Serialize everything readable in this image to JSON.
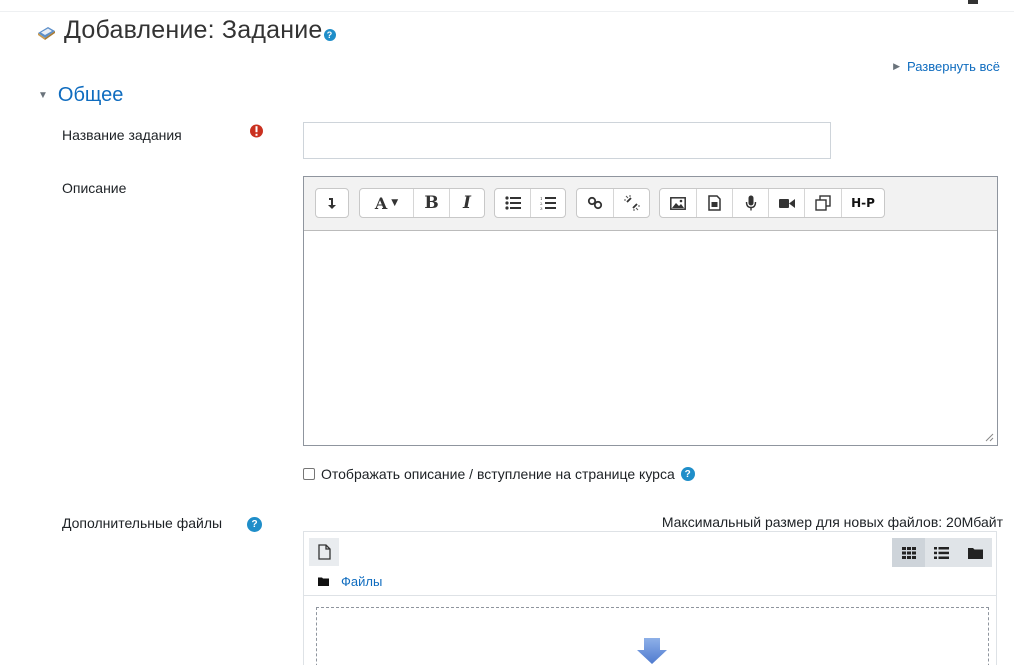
{
  "page": {
    "title": "Добавление: Задание",
    "expand_all": "Развернуть всё"
  },
  "section": {
    "general": "Общее"
  },
  "fields": {
    "assignment_name": {
      "label": "Название задания",
      "value": ""
    },
    "description": {
      "label": "Описание",
      "value": ""
    },
    "show_description": {
      "label": "Отображать описание / вступление на странице курса",
      "checked": false
    },
    "additional_files": {
      "label": "Дополнительные файлы"
    }
  },
  "editor": {
    "toolbar": [
      [
        "collapse-icon"
      ],
      [
        "font-style-icon",
        "bold-icon",
        "italic-icon"
      ],
      [
        "bullet-list-icon",
        "numbered-list-icon"
      ],
      [
        "link-icon",
        "unlink-icon"
      ],
      [
        "image-icon",
        "media-icon",
        "record-audio-icon",
        "record-video-icon",
        "manage-files-icon",
        "h5p-icon"
      ]
    ],
    "h5p_label": "H-P"
  },
  "filemanager": {
    "max_size": "Максимальный размер для новых файлов: 20Мбайт",
    "path_label": "Файлы",
    "view_modes": [
      "icons",
      "list",
      "tree"
    ],
    "active_view": "icons"
  },
  "colors": {
    "link": "#0f6cbf",
    "required": "#ca3120",
    "help": "#1f8ec9",
    "drop_arrow": "#5b86d6"
  }
}
